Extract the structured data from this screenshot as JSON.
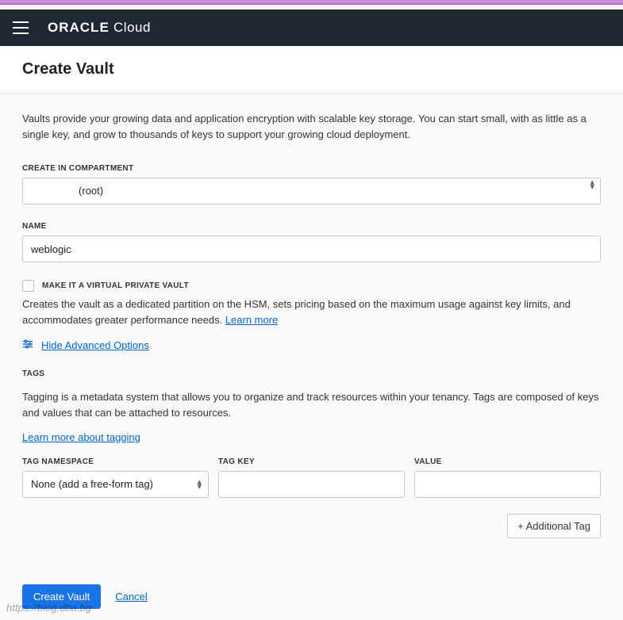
{
  "header": {
    "brand_bold": "ORACLE",
    "brand_light": "Cloud"
  },
  "page": {
    "title": "Create Vault",
    "intro": "Vaults provide your growing data and application encryption with scalable key storage. You can start small, with as little as a single key, and grow to thousands of keys to support your growing cloud deployment."
  },
  "compartment": {
    "label": "CREATE IN COMPARTMENT",
    "value": "(root)"
  },
  "name": {
    "label": "NAME",
    "value": "weblogic"
  },
  "vpv": {
    "checkbox_label": "MAKE IT A VIRTUAL PRIVATE VAULT",
    "helper": "Creates the vault as a dedicated partition on the HSM, sets pricing based on the maximum usage against key limits, and accommodates greater performance needs. ",
    "learn_more": "Learn more"
  },
  "advanced": {
    "toggle": "Hide Advanced Options"
  },
  "tags": {
    "heading": "TAGS",
    "desc": "Tagging is a metadata system that allows you to organize and track resources within your tenancy. Tags are composed of keys and values that can be attached to resources.",
    "learn_more": "Learn more about tagging",
    "namespace_label": "TAG NAMESPACE",
    "namespace_value": "None (add a free-form tag)",
    "key_label": "TAG KEY",
    "key_value": "",
    "value_label": "VALUE",
    "value_value": "",
    "add_btn": "+ Additional Tag"
  },
  "footer": {
    "create": "Create Vault",
    "cancel": "Cancel"
  },
  "watermark": "https://blog.dba.bg"
}
